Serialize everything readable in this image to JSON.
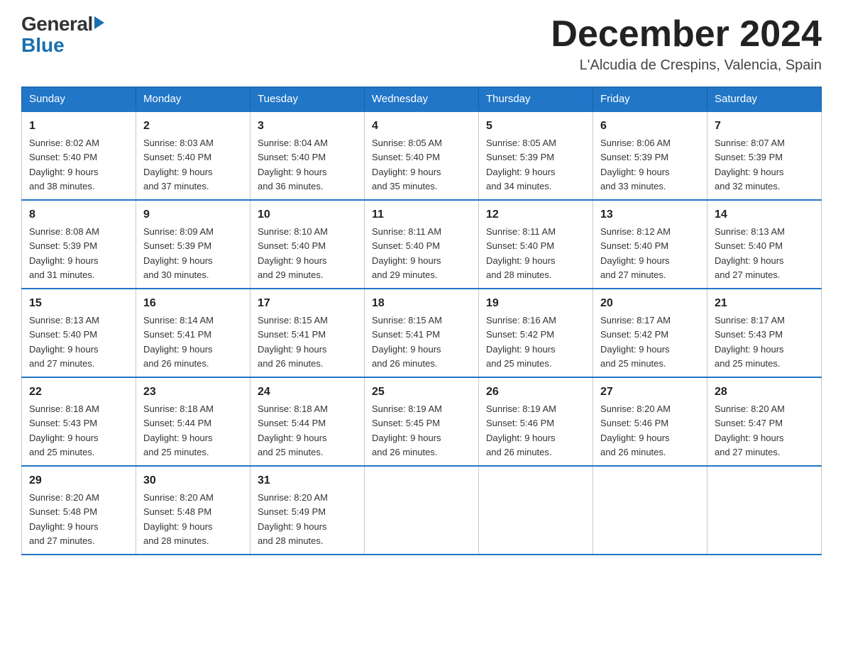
{
  "header": {
    "logo_general": "General",
    "logo_blue": "Blue",
    "month_title": "December 2024",
    "location": "L'Alcudia de Crespins, Valencia, Spain"
  },
  "days_of_week": [
    "Sunday",
    "Monday",
    "Tuesday",
    "Wednesday",
    "Thursday",
    "Friday",
    "Saturday"
  ],
  "weeks": [
    [
      {
        "day": "1",
        "sunrise": "8:02 AM",
        "sunset": "5:40 PM",
        "daylight": "9 hours and 38 minutes."
      },
      {
        "day": "2",
        "sunrise": "8:03 AM",
        "sunset": "5:40 PM",
        "daylight": "9 hours and 37 minutes."
      },
      {
        "day": "3",
        "sunrise": "8:04 AM",
        "sunset": "5:40 PM",
        "daylight": "9 hours and 36 minutes."
      },
      {
        "day": "4",
        "sunrise": "8:05 AM",
        "sunset": "5:40 PM",
        "daylight": "9 hours and 35 minutes."
      },
      {
        "day": "5",
        "sunrise": "8:05 AM",
        "sunset": "5:39 PM",
        "daylight": "9 hours and 34 minutes."
      },
      {
        "day": "6",
        "sunrise": "8:06 AM",
        "sunset": "5:39 PM",
        "daylight": "9 hours and 33 minutes."
      },
      {
        "day": "7",
        "sunrise": "8:07 AM",
        "sunset": "5:39 PM",
        "daylight": "9 hours and 32 minutes."
      }
    ],
    [
      {
        "day": "8",
        "sunrise": "8:08 AM",
        "sunset": "5:39 PM",
        "daylight": "9 hours and 31 minutes."
      },
      {
        "day": "9",
        "sunrise": "8:09 AM",
        "sunset": "5:39 PM",
        "daylight": "9 hours and 30 minutes."
      },
      {
        "day": "10",
        "sunrise": "8:10 AM",
        "sunset": "5:40 PM",
        "daylight": "9 hours and 29 minutes."
      },
      {
        "day": "11",
        "sunrise": "8:11 AM",
        "sunset": "5:40 PM",
        "daylight": "9 hours and 29 minutes."
      },
      {
        "day": "12",
        "sunrise": "8:11 AM",
        "sunset": "5:40 PM",
        "daylight": "9 hours and 28 minutes."
      },
      {
        "day": "13",
        "sunrise": "8:12 AM",
        "sunset": "5:40 PM",
        "daylight": "9 hours and 27 minutes."
      },
      {
        "day": "14",
        "sunrise": "8:13 AM",
        "sunset": "5:40 PM",
        "daylight": "9 hours and 27 minutes."
      }
    ],
    [
      {
        "day": "15",
        "sunrise": "8:13 AM",
        "sunset": "5:40 PM",
        "daylight": "9 hours and 27 minutes."
      },
      {
        "day": "16",
        "sunrise": "8:14 AM",
        "sunset": "5:41 PM",
        "daylight": "9 hours and 26 minutes."
      },
      {
        "day": "17",
        "sunrise": "8:15 AM",
        "sunset": "5:41 PM",
        "daylight": "9 hours and 26 minutes."
      },
      {
        "day": "18",
        "sunrise": "8:15 AM",
        "sunset": "5:41 PM",
        "daylight": "9 hours and 26 minutes."
      },
      {
        "day": "19",
        "sunrise": "8:16 AM",
        "sunset": "5:42 PM",
        "daylight": "9 hours and 25 minutes."
      },
      {
        "day": "20",
        "sunrise": "8:17 AM",
        "sunset": "5:42 PM",
        "daylight": "9 hours and 25 minutes."
      },
      {
        "day": "21",
        "sunrise": "8:17 AM",
        "sunset": "5:43 PM",
        "daylight": "9 hours and 25 minutes."
      }
    ],
    [
      {
        "day": "22",
        "sunrise": "8:18 AM",
        "sunset": "5:43 PM",
        "daylight": "9 hours and 25 minutes."
      },
      {
        "day": "23",
        "sunrise": "8:18 AM",
        "sunset": "5:44 PM",
        "daylight": "9 hours and 25 minutes."
      },
      {
        "day": "24",
        "sunrise": "8:18 AM",
        "sunset": "5:44 PM",
        "daylight": "9 hours and 25 minutes."
      },
      {
        "day": "25",
        "sunrise": "8:19 AM",
        "sunset": "5:45 PM",
        "daylight": "9 hours and 26 minutes."
      },
      {
        "day": "26",
        "sunrise": "8:19 AM",
        "sunset": "5:46 PM",
        "daylight": "9 hours and 26 minutes."
      },
      {
        "day": "27",
        "sunrise": "8:20 AM",
        "sunset": "5:46 PM",
        "daylight": "9 hours and 26 minutes."
      },
      {
        "day": "28",
        "sunrise": "8:20 AM",
        "sunset": "5:47 PM",
        "daylight": "9 hours and 27 minutes."
      }
    ],
    [
      {
        "day": "29",
        "sunrise": "8:20 AM",
        "sunset": "5:48 PM",
        "daylight": "9 hours and 27 minutes."
      },
      {
        "day": "30",
        "sunrise": "8:20 AM",
        "sunset": "5:48 PM",
        "daylight": "9 hours and 28 minutes."
      },
      {
        "day": "31",
        "sunrise": "8:20 AM",
        "sunset": "5:49 PM",
        "daylight": "9 hours and 28 minutes."
      },
      null,
      null,
      null,
      null
    ]
  ]
}
